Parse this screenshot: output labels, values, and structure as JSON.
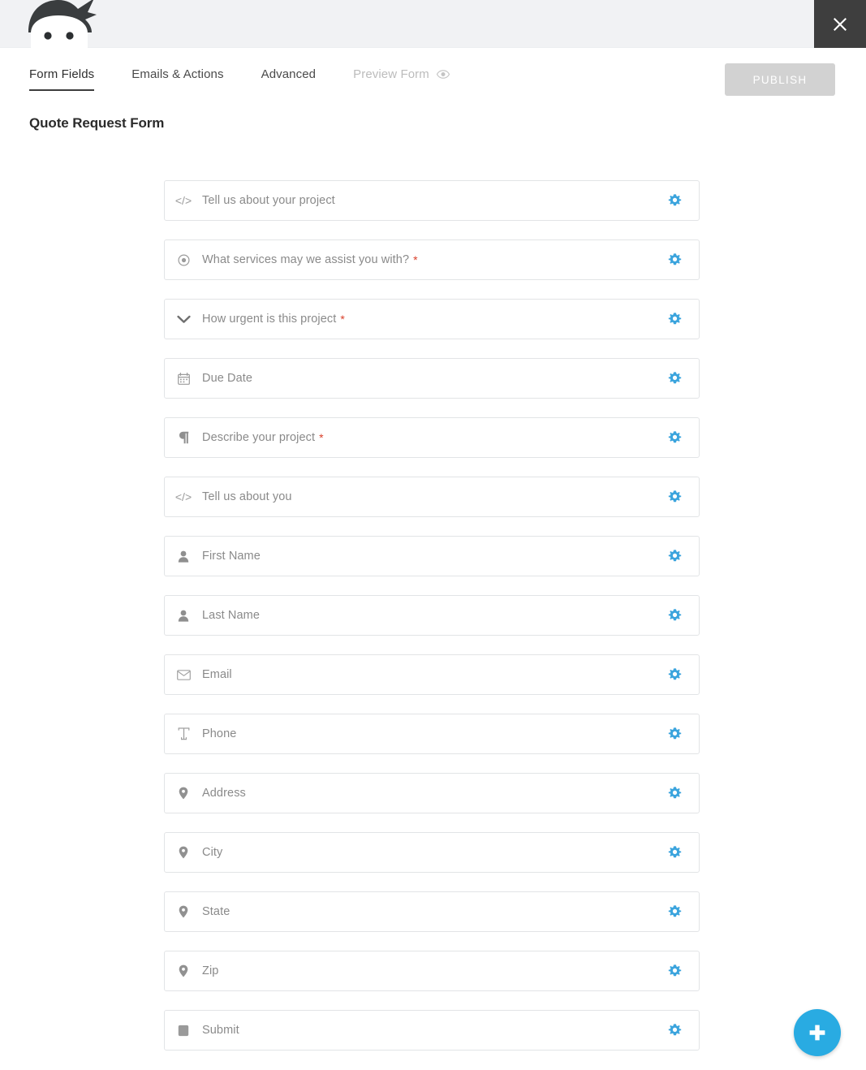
{
  "window": {
    "close_label": "✕"
  },
  "header": {
    "logo_name": "ninja-forms-logo",
    "tabs": [
      {
        "label": "Form Fields",
        "active": true
      },
      {
        "label": "Emails & Actions",
        "active": false
      },
      {
        "label": "Advanced",
        "active": false
      }
    ],
    "preview_label": "Preview Form",
    "publish_label": "PUBLISH",
    "title": "Quote Request Form"
  },
  "colors": {
    "accent": "#29abe2",
    "gear": "#3ba4dd",
    "required": "#d9402b",
    "topbar": "#f1f2f4",
    "close_bg": "#3e3e3e",
    "publish_bg": "#d2d2d2"
  },
  "fields": [
    {
      "label": "Tell us about your project",
      "required": false,
      "icon": "code-icon",
      "type": "html"
    },
    {
      "label": "What services may we assist you with?",
      "required": true,
      "icon": "radio-icon",
      "type": "listradio"
    },
    {
      "label": "How urgent is this project",
      "required": true,
      "icon": "chevron-down-icon",
      "type": "listselect"
    },
    {
      "label": "Due Date",
      "required": false,
      "icon": "calendar-icon",
      "type": "date"
    },
    {
      "label": "Describe your project",
      "required": true,
      "icon": "paragraph-icon",
      "type": "textarea"
    },
    {
      "label": "Tell us about you",
      "required": false,
      "icon": "code-icon",
      "type": "html"
    },
    {
      "label": "First Name",
      "required": false,
      "icon": "user-icon",
      "type": "firstname"
    },
    {
      "label": "Last Name",
      "required": false,
      "icon": "user-icon",
      "type": "lastname"
    },
    {
      "label": "Email",
      "required": false,
      "icon": "envelope-icon",
      "type": "email"
    },
    {
      "label": "Phone",
      "required": false,
      "icon": "text-icon",
      "type": "textbox"
    },
    {
      "label": "Address",
      "required": false,
      "icon": "map-pin-icon",
      "type": "address"
    },
    {
      "label": "City",
      "required": false,
      "icon": "map-pin-icon",
      "type": "city"
    },
    {
      "label": "State",
      "required": false,
      "icon": "map-pin-icon",
      "type": "state"
    },
    {
      "label": "Zip",
      "required": false,
      "icon": "map-pin-icon",
      "type": "zip"
    },
    {
      "label": "Submit",
      "required": false,
      "icon": "button-icon",
      "type": "submit"
    }
  ],
  "add_field": {
    "name": "add-field-button",
    "label": "+"
  }
}
